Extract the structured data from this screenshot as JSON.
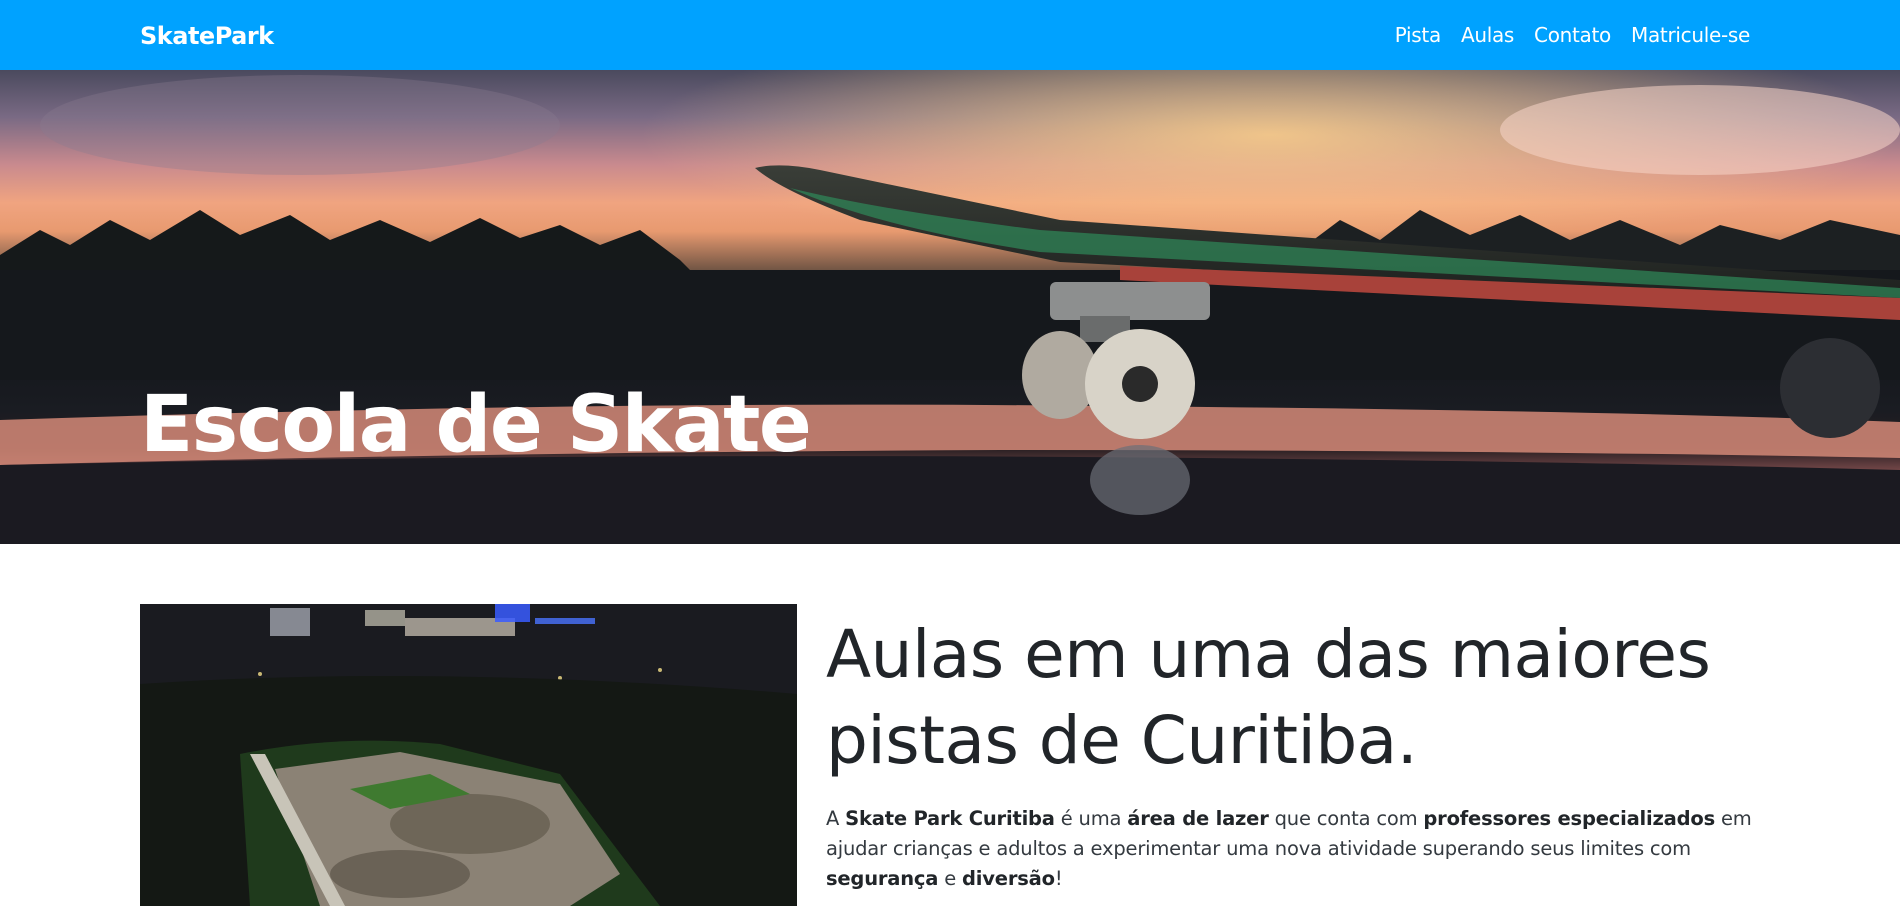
{
  "navbar": {
    "brand": "SkatePark",
    "links": [
      "Pista",
      "Aulas",
      "Contato",
      "Matricule-se"
    ],
    "background": "#00a2ff"
  },
  "hero": {
    "title": "Escola de Skate",
    "image": "sunset-skateboard-photo"
  },
  "content": {
    "image": "skatepark-aerial-night-photo",
    "headline_line1": "Aulas em uma das maiores",
    "headline_line2": "pistas de Curitiba.",
    "intro": {
      "t1": "A ",
      "b1": "Skate Park Curitiba",
      "t2": " é uma ",
      "b2": "área de lazer",
      "t3": " que conta com ",
      "b3": "professores especializados",
      "t4": " em ajudar crianças e adultos a experimentar uma nova atividade superando seus limites com ",
      "b4": "segurança",
      "t5": " e ",
      "b5": "diversão",
      "t6": "!"
    }
  }
}
